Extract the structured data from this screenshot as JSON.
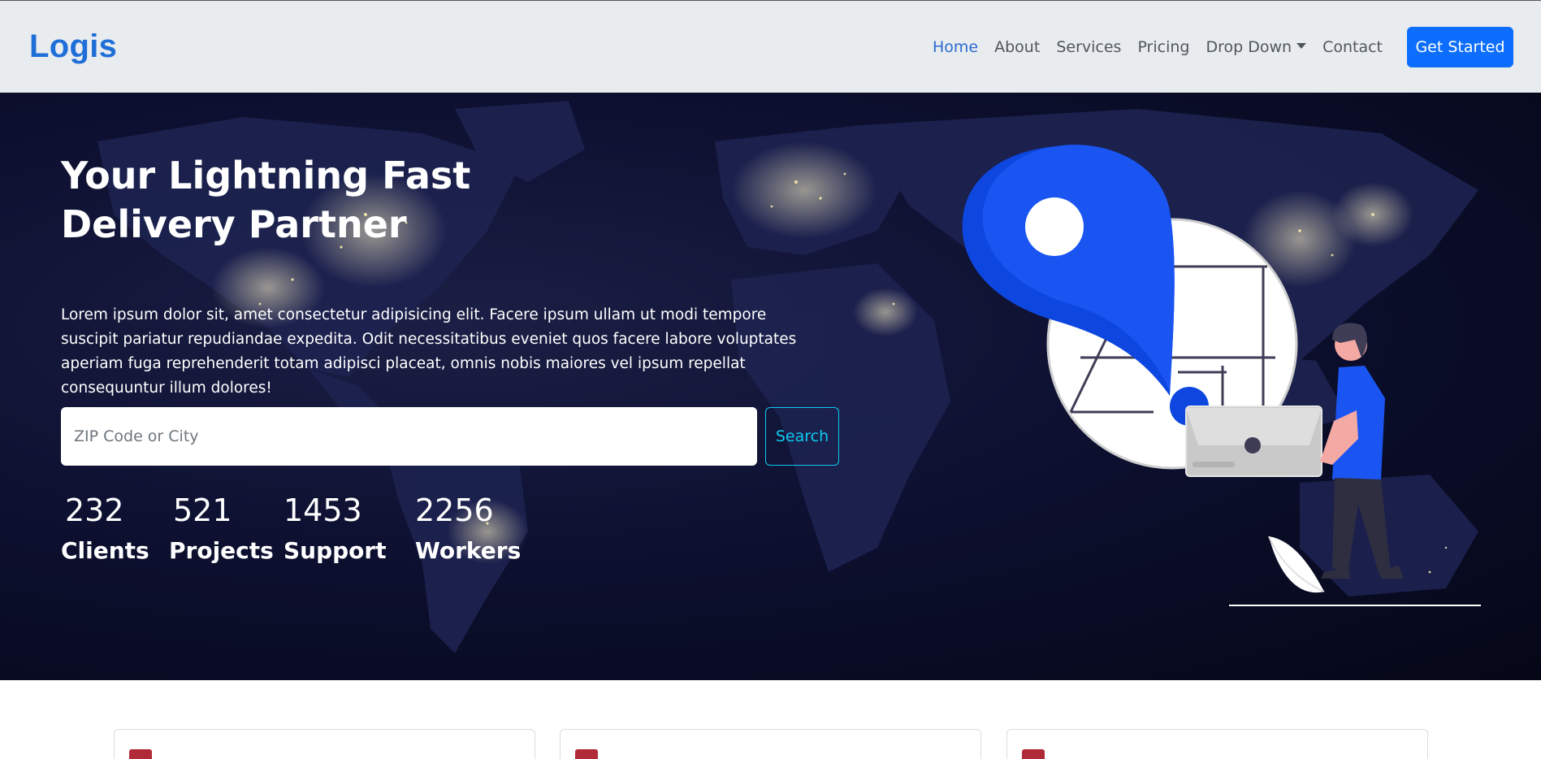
{
  "navbar": {
    "brand": "Logis",
    "links": [
      {
        "label": "Home"
      },
      {
        "label": "About"
      },
      {
        "label": "Services"
      },
      {
        "label": "Pricing"
      },
      {
        "label": "Drop Down"
      },
      {
        "label": "Contact"
      }
    ],
    "cta_label": "Get Started"
  },
  "hero": {
    "title_line1": "Your Lightning Fast",
    "title_line2": "Delivery Partner",
    "text": "Lorem ipsum dolor sit, amet consectetur adipisicing elit. Facere ipsum ullam ut modi tempore suscipit pariatur repudiandae expedita. Odit necessitatibus eveniet quos facere labore voluptates aperiam fuga reprehenderit totam adipisci placeat, omnis nobis maiores vel ipsum repellat consequuntur illum dolores!",
    "search": {
      "placeholder": "ZIP Code or City",
      "value": "",
      "button_label": "Search"
    },
    "stats": [
      {
        "number": "232",
        "label": "Clients"
      },
      {
        "number": "521",
        "label": "Projects"
      },
      {
        "number": "1453",
        "label": "Support"
      },
      {
        "number": "2256",
        "label": "Workers"
      }
    ]
  },
  "colors": {
    "brand": "#1f6fd8",
    "primary": "#0d6efd",
    "info": "#0dcaf0",
    "accent_red": "#b02a37",
    "hero_bg": "#0d1030"
  }
}
